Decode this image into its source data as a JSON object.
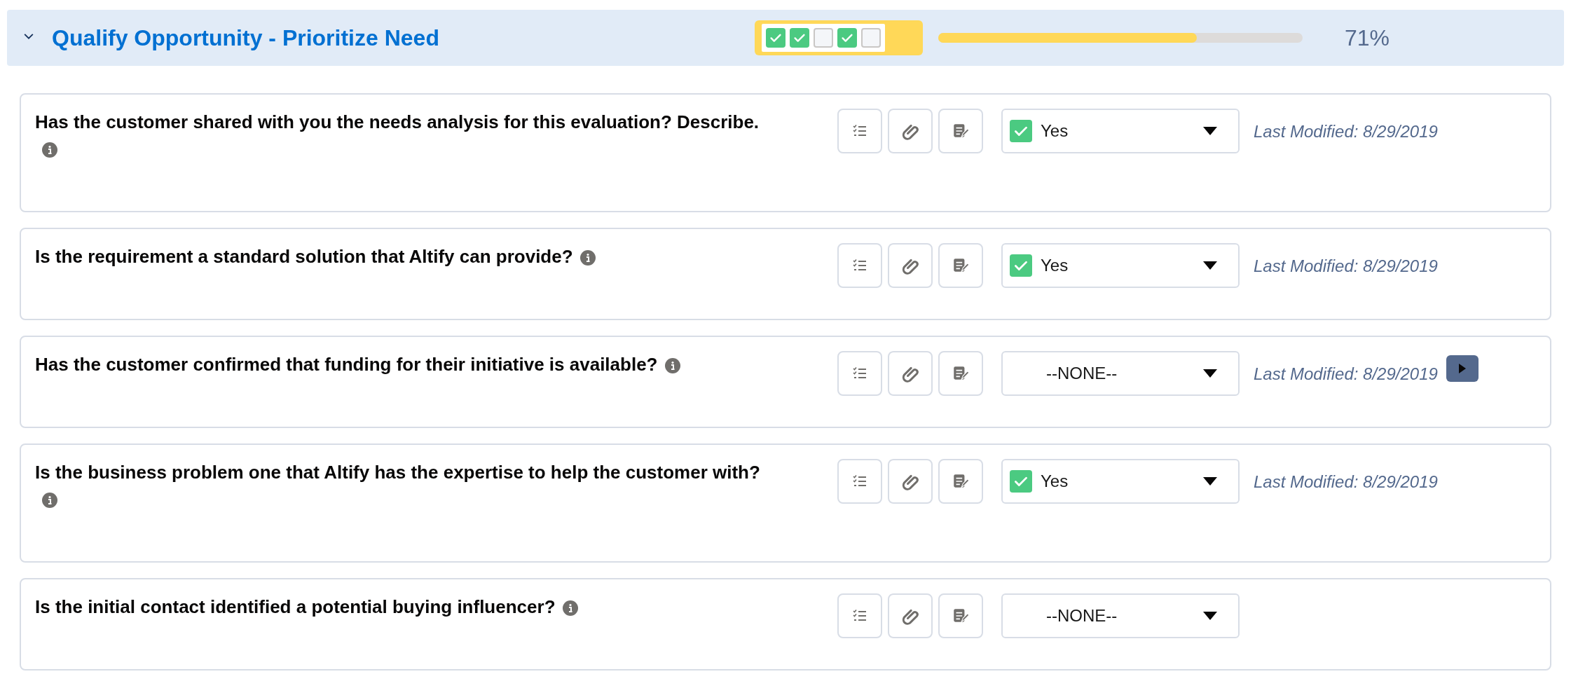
{
  "section": {
    "title": "Qualify Opportunity - Prioritize Need",
    "expanded": true,
    "checklist": [
      {
        "checked": true
      },
      {
        "checked": true
      },
      {
        "checked": false
      },
      {
        "checked": true
      },
      {
        "checked": false
      }
    ],
    "progress": {
      "level": 0.71,
      "reading": "71%"
    }
  },
  "questions": [
    {
      "text": "Has the customer shared with you the needs analysis for this evaluation? Describe.",
      "answer": {
        "value": "Yes",
        "checked": true
      },
      "last_modified": "Last Modified: 8/29/2019",
      "next_button": false
    },
    {
      "text": "Is the requirement a standard solution that Altify can provide?",
      "answer": {
        "value": "Yes",
        "checked": true
      },
      "last_modified": "Last Modified: 8/29/2019",
      "next_button": false
    },
    {
      "text": "Has the customer confirmed that funding for their initiative is available?",
      "answer": {
        "value": "--NONE--",
        "checked": false
      },
      "last_modified": "Last Modified: 8/29/2019",
      "next_button": true
    },
    {
      "text": "Is the business problem one that Altify has the expertise to help the customer with?",
      "answer": {
        "value": "Yes",
        "checked": true
      },
      "last_modified": "Last Modified: 8/29/2019",
      "next_button": false
    },
    {
      "text": "Is the initial contact identified a potential buying influencer?",
      "answer": {
        "value": "--NONE--",
        "checked": false
      },
      "next_button": false
    }
  ]
}
